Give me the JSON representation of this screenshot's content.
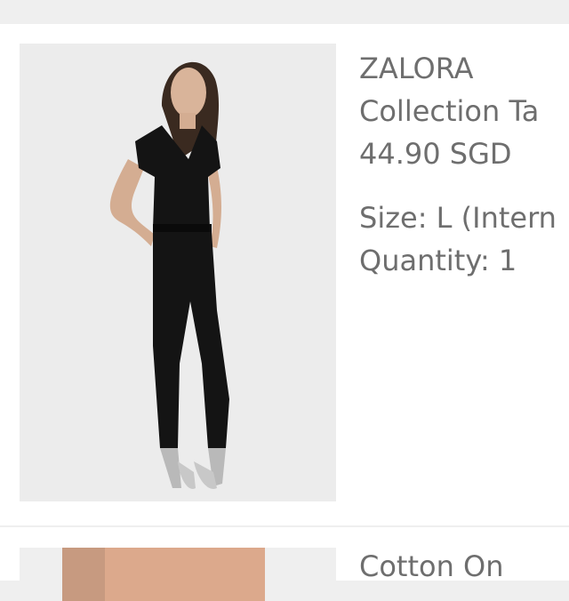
{
  "items": [
    {
      "brand": "ZALORA",
      "name": "Collection Ta",
      "price": "44.90 SGD",
      "size": "Size: L (Intern",
      "quantity": "Quantity: 1",
      "image_icon": "product-photo-jumpsuit"
    },
    {
      "brand": "Cotton On",
      "image_icon": "product-photo"
    }
  ],
  "colors": {
    "background": "#efefef",
    "card": "#ffffff",
    "text": "#6e6e6e"
  }
}
